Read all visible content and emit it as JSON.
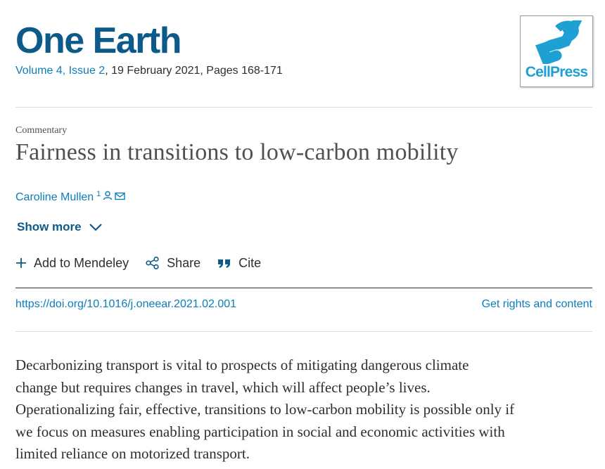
{
  "journal": {
    "title": "One Earth",
    "volume_issue": "Volume 4, Issue 2",
    "date_pages": ", 19 February 2021, Pages 168-171"
  },
  "publisher_logo": {
    "text": "CellPress",
    "color": "#1ea0d4"
  },
  "article": {
    "type": "Commentary",
    "title": "Fairness in transitions to low-carbon mobility",
    "author": "Caroline Mullen",
    "author_sup": "1",
    "author_icons": [
      "person-icon",
      "envelope-icon"
    ]
  },
  "show_more": {
    "label": "Show more",
    "icon": "chevron-down-icon"
  },
  "actions": {
    "mendeley": "Add to Mendeley",
    "share": "Share",
    "cite": "Cite"
  },
  "links": {
    "doi": "https://doi.org/10.1016/j.oneear.2021.02.001",
    "rights": "Get rights and content"
  },
  "abstract": {
    "line1": "Decarbonizing transport is vital to prospects of mitigating dangerous climate",
    "line2": "change but requires changes in travel, which will affect people’s lives.",
    "line3": "Operationalizing fair, effective, transitions to low-carbon mobility is possible only if",
    "line4": "we focus on measures enabling participation in social and economic activities with",
    "line5": "limited reliance on motorized transport."
  },
  "colors": {
    "brand": "#0c5a8a",
    "link": "#0c7dbb",
    "text": "#2e2e2e"
  }
}
